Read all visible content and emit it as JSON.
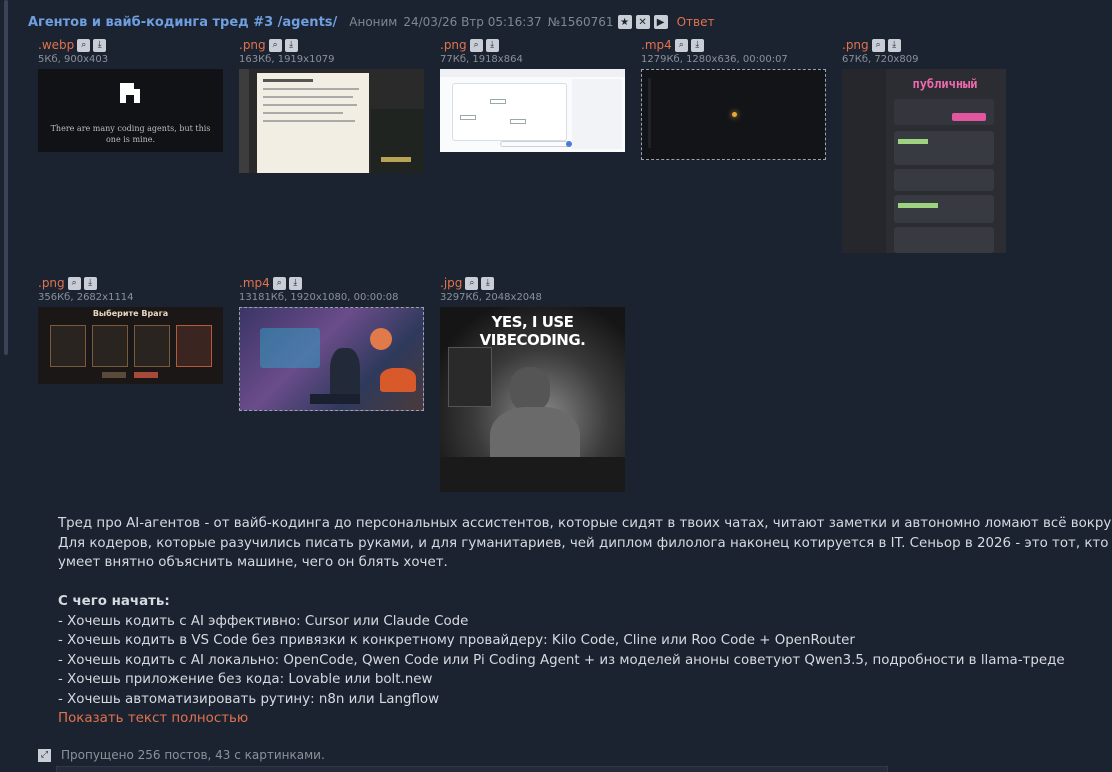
{
  "header": {
    "title": "Агентов и вайб-кодинга тред #3 /agents/",
    "author": "Аноним",
    "datetime": "24/03/26 Втр 05:16:37",
    "post_number": "№1560761",
    "reply_label": "Ответ",
    "icons": [
      "star-icon",
      "close-icon",
      "play-icon"
    ]
  },
  "files": [
    {
      "ext": ".webp",
      "info": "5Кб, 900x403",
      "caption": "There are many coding agents, but this one is mine."
    },
    {
      "ext": ".png",
      "info": "163Кб, 1919x1079"
    },
    {
      "ext": ".png",
      "info": "77Кб, 1918x864"
    },
    {
      "ext": ".mp4",
      "info": "1279Кб, 1280x636, 00:00:07"
    },
    {
      "ext": ".png",
      "info": "67Кб, 720x809",
      "caption": "публичный"
    },
    {
      "ext": ".png",
      "info": "356Кб, 2682x1114",
      "caption": "Выберите Врага"
    },
    {
      "ext": ".mp4",
      "info": "13181Кб, 1920x1080, 00:00:08"
    },
    {
      "ext": ".jpg",
      "info": "3297Кб, 2048x2048",
      "caption": "YES, I USE VIBECODING."
    }
  ],
  "post": {
    "line1": "Тред про AI-агентов - от вайб-кодинга до персональных ассистентов, которые сидят в твоих чатах, читают заметки и автономно ломают всё вокруг.",
    "line2": "Для кодеров, которые разучились писать руками, и для гуманитариев, чей диплом филолога наконец котируется в IT. Сеньор в 2026 - это тот, кто",
    "line3": "умеет внятно объяснить машине, чего он блять хочет.",
    "heading": "С чего начать:",
    "items": [
      "- Хочешь кодить с AI эффективно: Cursor или Claude Code",
      "- Хочешь кодить в VS Code без привязки к конкретному провайдеру: Kilo Code, Cline или Roo Code + OpenRouter",
      "- Хочешь кодить с AI локально: OpenCode, Qwen Code или Pi Coding Agent + из моделей аноны советуют Qwen3.5, подробности в llama-треде",
      "- Хочешь приложение без кода: Lovable или bolt.new",
      "- Хочешь автоматизировать рутину: n8n или Langflow"
    ],
    "show_more": "Показать текст полностью"
  },
  "omitted": "Пропущено 256 постов, 43 с картинками."
}
